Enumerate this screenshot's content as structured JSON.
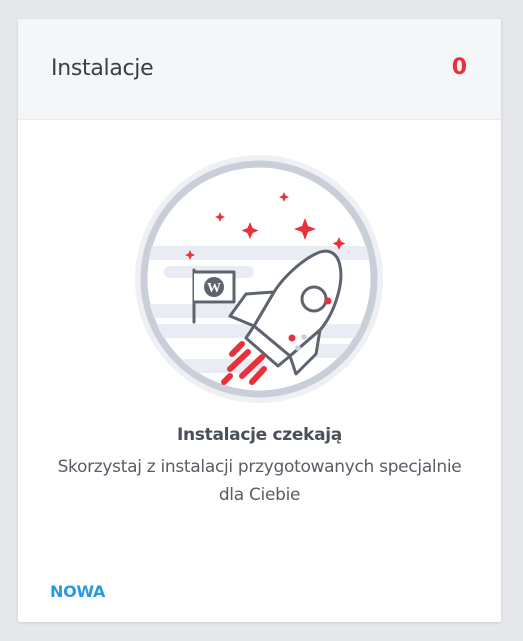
{
  "card": {
    "title": "Instalacje",
    "count": "0"
  },
  "empty_state": {
    "title": "Instalacje czekają",
    "description": "Skorzystaj z instalacji przygotowanych specjalnie dla Ciebie",
    "illustration_icon": "rocket-icon",
    "wordpress_icon": "wordpress-icon"
  },
  "footer": {
    "new_label": "NOWA"
  },
  "colors": {
    "accent_red": "#e8313a",
    "link_blue": "#2a9be0",
    "header_bg": "#f5f6f8",
    "page_bg": "#e5e7ea"
  }
}
